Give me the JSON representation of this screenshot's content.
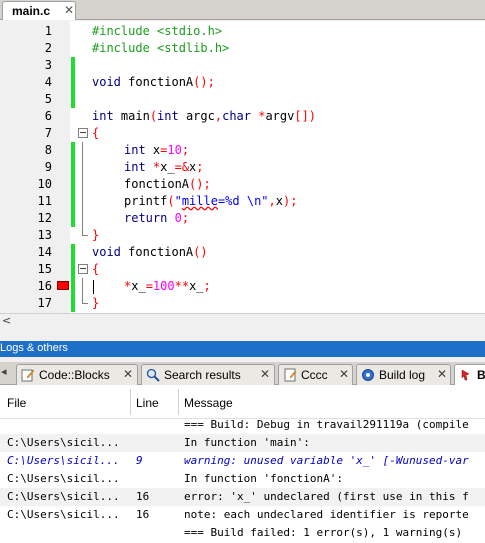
{
  "editor_tab": {
    "title": "main.c",
    "close": "✕"
  },
  "code_lines": [
    {
      "n": "1",
      "text": "#include <stdio.h>"
    },
    {
      "n": "2",
      "text": "#include <stdlib.h>"
    },
    {
      "n": "3",
      "text": ""
    },
    {
      "n": "4",
      "kw": "void",
      "rest": " fonctionA",
      "op": "();"
    },
    {
      "n": "5",
      "text": ""
    },
    {
      "n": "6",
      "kw": "int",
      "rest": " main",
      "p1": "(",
      "kw2": "int",
      "r2": " argc",
      "p2": ",",
      "kw3": "char",
      "p3": " *",
      "r3": "argv",
      "p4": "[])"
    },
    {
      "n": "7",
      "op": "{"
    },
    {
      "n": "8",
      "kw": "int",
      "rest": " x",
      "op": "=",
      "num": "10",
      "op2": ";"
    },
    {
      "n": "9",
      "kw": "int",
      "op": " *",
      "rest": "x_",
      "op2": "=&",
      "rest2": "x",
      "op3": ";"
    },
    {
      "n": "10",
      "rest": "fonctionA",
      "op": "();"
    },
    {
      "n": "11",
      "rest": "printf",
      "op": "(",
      "str_a": "\"",
      "str_b": "mille",
      "str_c": "=%d \\n\"",
      "op2": ",",
      "rest2": "x",
      "op3": ");"
    },
    {
      "n": "12",
      "kw": "return",
      "op": " ",
      "num": "0",
      "op2": ";"
    },
    {
      "n": "13",
      "op": "}"
    },
    {
      "n": "14",
      "kw": "void",
      "rest": " fonctionA",
      "op": "()"
    },
    {
      "n": "15",
      "op": "{"
    },
    {
      "n": "16",
      "op": "*",
      "rest": "x_",
      "op2": "=",
      "num": "100",
      "op3": "**",
      "rest2": "x_",
      "op4": ";"
    },
    {
      "n": "17",
      "op": "}"
    }
  ],
  "scroll_left": "<",
  "logs_header": "Logs & others",
  "logs_scroll_left": "◂",
  "log_tabs": [
    {
      "label": "Code::Blocks",
      "icon": "code-blocks-icon",
      "close": "✕"
    },
    {
      "label": "Search results",
      "icon": "search-icon",
      "close": "✕"
    },
    {
      "label": "Cccc",
      "icon": "document-icon",
      "close": "✕"
    },
    {
      "label": "Build log",
      "icon": "build-log-icon",
      "close": "✕"
    },
    {
      "label": "B",
      "icon": "build-messages-icon"
    }
  ],
  "messages": {
    "columns": [
      "File",
      "Line",
      "Message"
    ],
    "rows": [
      {
        "file": "",
        "line": "",
        "msg": "=== Build: Debug in travail291119a (compile"
      },
      {
        "file": "C:\\Users\\sicil...",
        "line": "",
        "msg": "In function 'main':"
      },
      {
        "file": "C:\\Users\\sicil...",
        "line": "9",
        "msg": "warning: unused variable 'x_' [-Wunused-var"
      },
      {
        "file": "C:\\Users\\sicil...",
        "line": "",
        "msg": "In function 'fonctionA':"
      },
      {
        "file": "C:\\Users\\sicil...",
        "line": "16",
        "msg": "error: 'x_' undeclared (first use in this f"
      },
      {
        "file": "C:\\Users\\sicil...",
        "line": "16",
        "msg": "note: each undeclared identifier is reporte"
      },
      {
        "file": "",
        "line": "",
        "msg": "=== Build failed: 1 error(s), 1 warning(s)"
      }
    ]
  }
}
